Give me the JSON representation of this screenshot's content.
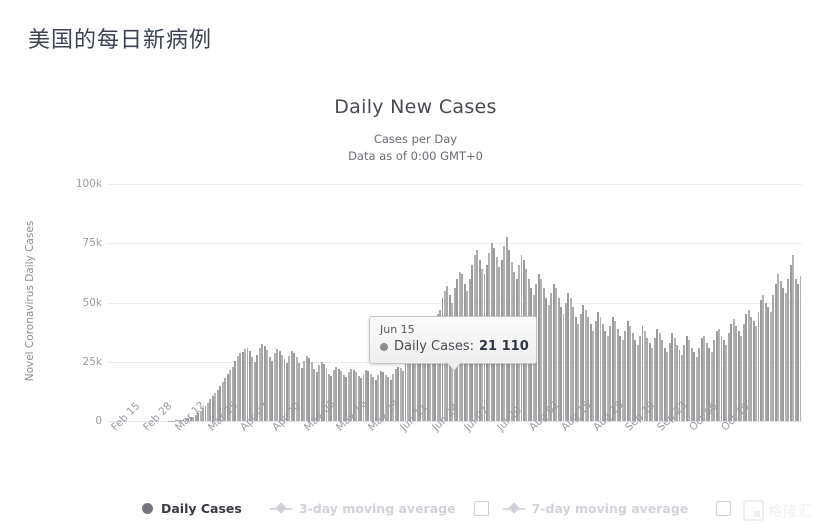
{
  "page": {
    "title": "美国的每日新病例"
  },
  "chart": {
    "title": "Daily New Cases",
    "subtitle1": "Cases per Day",
    "subtitle2": "Data as of 0:00 GMT+0",
    "y_axis_title": "Novel Coronavirus Daily Cases",
    "y_ticks": [
      "100k",
      "75k",
      "50k",
      "25k",
      "0"
    ]
  },
  "tooltip": {
    "date": "Jun 15",
    "series_label": "Daily Cases:",
    "value": "21 110"
  },
  "legend": {
    "items": [
      {
        "label": "Daily Cases",
        "active": true,
        "has_checkbox": false
      },
      {
        "label": "3-day moving average",
        "active": false,
        "has_checkbox": true
      },
      {
        "label": "7-day moving average",
        "active": false,
        "has_checkbox": true
      }
    ]
  },
  "watermark": {
    "text": "格隆汇"
  },
  "chart_data": {
    "type": "bar",
    "title": "Daily New Cases",
    "subtitle": "Cases per Day — Data as of 0:00 GMT+0",
    "xlabel": "",
    "ylabel": "Novel Coronavirus Daily Cases",
    "ylim": [
      0,
      100000
    ],
    "ytick_values": [
      0,
      25000,
      50000,
      75000,
      100000
    ],
    "grid": true,
    "legend_position": "bottom",
    "bar_color": "#a6a6a6",
    "highlight": {
      "x": "Jun 15",
      "y": 21110
    },
    "x_tick_labels": [
      "Feb 15",
      "Feb 28",
      "Mar 12",
      "Mar 25",
      "Apr 07",
      "Apr 20",
      "May 03",
      "May 16",
      "May 29",
      "Jun 11",
      "Jun 24",
      "Jul 07",
      "Jul 20",
      "Aug 02",
      "Aug 15",
      "Aug 28",
      "Sep 10",
      "Sep 23",
      "Oct 06",
      "Oct 19"
    ],
    "x_tick_interval_days": 13,
    "x_start": "Feb 15",
    "series": [
      {
        "name": "Daily Cases",
        "values": [
          0,
          0,
          0,
          0,
          0,
          0,
          0,
          0,
          0,
          0,
          0,
          0,
          0,
          0,
          0,
          0,
          0,
          0,
          0,
          0,
          0,
          0,
          0,
          0,
          80,
          120,
          180,
          240,
          320,
          420,
          560,
          780,
          1100,
          1500,
          1900,
          2600,
          3400,
          4300,
          5500,
          6500,
          7800,
          9200,
          10500,
          11800,
          13000,
          14800,
          16500,
          18200,
          19800,
          21500,
          23000,
          25500,
          27500,
          28500,
          29000,
          30500,
          31000,
          29500,
          27000,
          25000,
          28000,
          31000,
          32500,
          31500,
          30000,
          27000,
          25500,
          28500,
          30500,
          29500,
          28000,
          26000,
          24500,
          27500,
          29500,
          28500,
          27000,
          24500,
          22500,
          25500,
          27500,
          26500,
          25000,
          22000,
          20500,
          23500,
          25000,
          24000,
          22500,
          20000,
          19000,
          21500,
          23000,
          22000,
          21000,
          19500,
          18500,
          20500,
          22000,
          21500,
          20500,
          19000,
          18000,
          20000,
          21500,
          21000,
          20000,
          18500,
          17500,
          19500,
          21110,
          20500,
          19500,
          18500,
          17500,
          20000,
          22000,
          23000,
          22500,
          21000,
          24000,
          26500,
          28000,
          27000,
          25500,
          24000,
          27000,
          31000,
          34000,
          36000,
          38000,
          40000,
          43000,
          45000,
          47000,
          52000,
          55000,
          57000,
          53000,
          50000,
          56000,
          60000,
          63000,
          62000,
          58000,
          55000,
          60000,
          66000,
          70000,
          72000,
          68000,
          64000,
          62000,
          66000,
          71000,
          75000,
          73000,
          69000,
          65000,
          68000,
          74000,
          77500,
          72000,
          67000,
          63000,
          60000,
          66000,
          70000,
          68000,
          64000,
          60000,
          56000,
          53000,
          58000,
          62000,
          60000,
          56000,
          52000,
          49000,
          54000,
          58000,
          56000,
          52000,
          48000,
          45000,
          50000,
          54000,
          52000,
          48000,
          44000,
          41000,
          45000,
          49000,
          47000,
          44000,
          41000,
          38000,
          42000,
          46000,
          44000,
          41000,
          38000,
          36000,
          40000,
          44000,
          42000,
          39000,
          36000,
          34000,
          38000,
          42000,
          40000,
          37000,
          34000,
          32000,
          36000,
          40000,
          38000,
          35000,
          33000,
          31000,
          35000,
          39000,
          37000,
          34000,
          31000,
          29000,
          33000,
          37000,
          35000,
          32000,
          30000,
          28000,
          32000,
          36000,
          34000,
          31000,
          29000,
          27000,
          31000,
          35000,
          36000,
          33000,
          31000,
          29000,
          34000,
          38000,
          39000,
          36000,
          34000,
          32000,
          37000,
          41000,
          43000,
          40000,
          38000,
          36000,
          41000,
          45000,
          47000,
          44000,
          42000,
          40000,
          46000,
          51000,
          53000,
          50000,
          48000,
          46000,
          53000,
          58000,
          62000,
          59000,
          56000,
          54000,
          60000,
          66000,
          70000,
          60000,
          58000,
          61000
        ]
      }
    ]
  }
}
